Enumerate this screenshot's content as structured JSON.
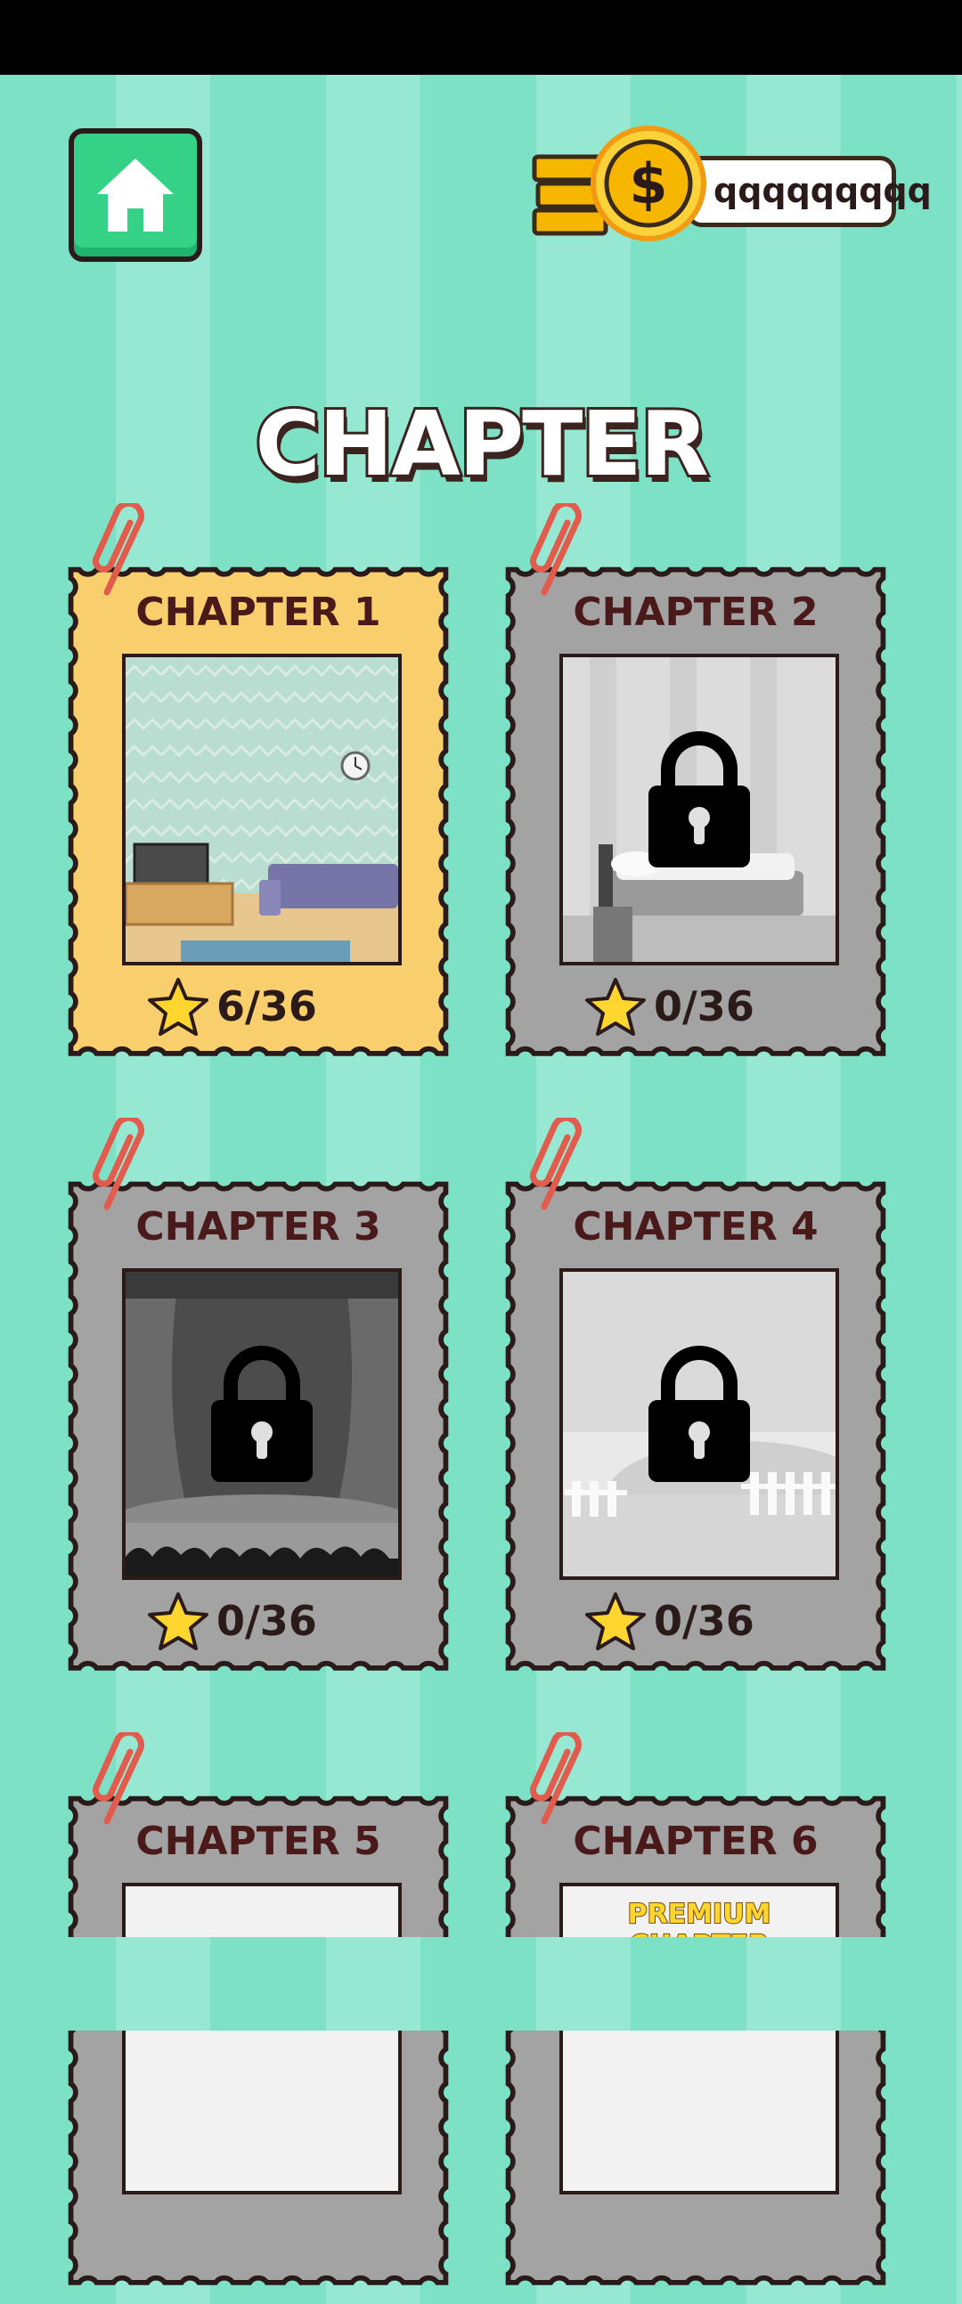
{
  "header": {
    "home_button": "home-icon",
    "coins": "qqqqqqqqq",
    "coin_icon": "dollar-coin-icon"
  },
  "title": "CHAPTER",
  "chapters": [
    {
      "label": "CHAPTER 1",
      "stars": "6/36",
      "locked": false,
      "color": "#f9cf6e",
      "image": "living-room"
    },
    {
      "label": "CHAPTER 2",
      "stars": "0/36",
      "locked": true,
      "color": "#a3a3a3",
      "image": "bedroom"
    },
    {
      "label": "CHAPTER 3",
      "stars": "0/36",
      "locked": true,
      "color": "#a3a3a3",
      "image": "theater-stage"
    },
    {
      "label": "CHAPTER 4",
      "stars": "0/36",
      "locked": true,
      "color": "#a3a3a3",
      "image": "farm-fence"
    },
    {
      "label": "CHAPTER 5",
      "locked": true,
      "color": "#a3a3a3"
    },
    {
      "label": "CHAPTER 6",
      "premium_label": "PREMIUM CHAPTER",
      "locked": true,
      "color": "#a3a3a3"
    }
  ],
  "colors": {
    "background_stripe_a": "#7de1c6",
    "background_stripe_b": "#96e8d3",
    "home_button": "#35d186",
    "unlocked_card": "#f9cf6e",
    "locked_card": "#a3a3a3",
    "star": "#ffd530"
  }
}
